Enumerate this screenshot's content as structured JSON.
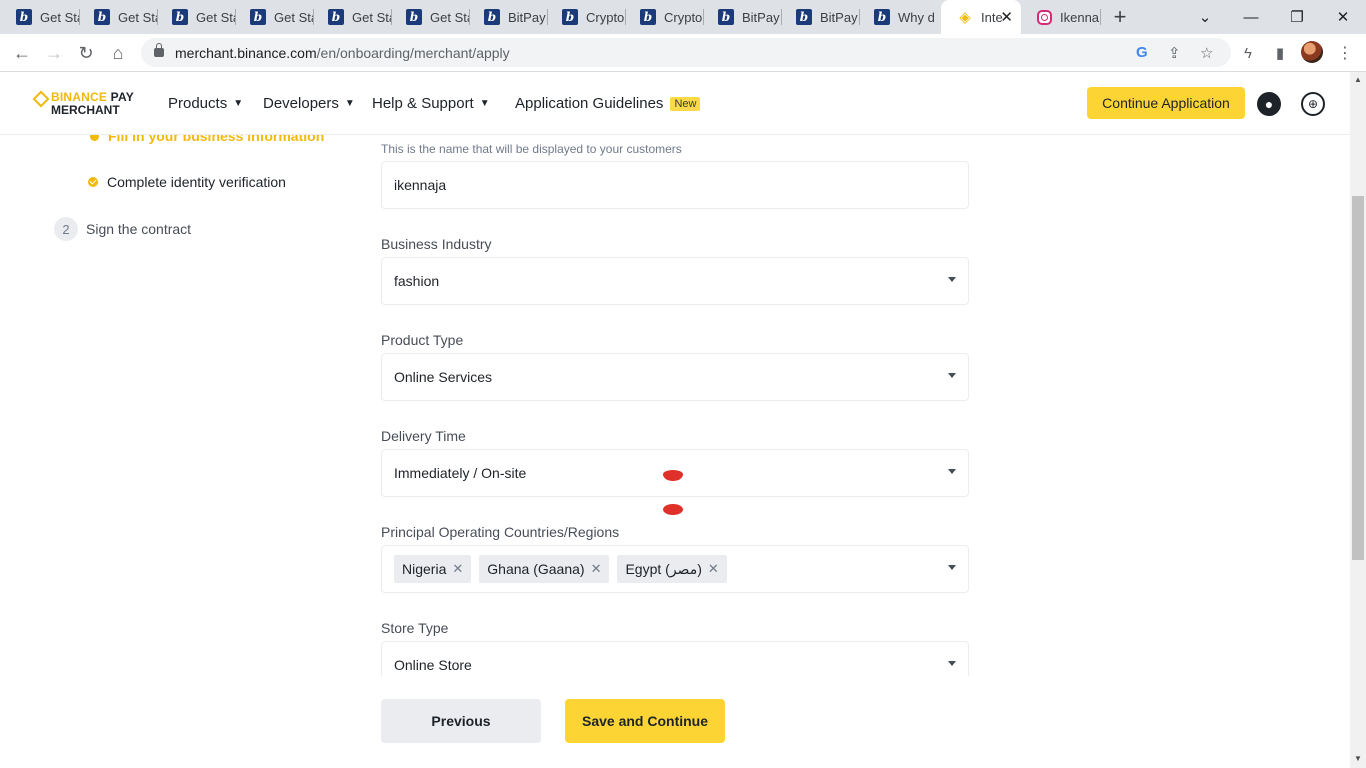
{
  "browser": {
    "tabs": [
      {
        "title": "Get Sta",
        "icon": "bitpay-icon"
      },
      {
        "title": "Get Sta",
        "icon": "bitpay-icon"
      },
      {
        "title": "Get Sta",
        "icon": "bitpay-icon"
      },
      {
        "title": "Get Sta",
        "icon": "bitpay-icon"
      },
      {
        "title": "Get Sta",
        "icon": "bitpay-icon"
      },
      {
        "title": "Get Sta",
        "icon": "bitpay-icon"
      },
      {
        "title": "BitPay",
        "icon": "bitpay-icon"
      },
      {
        "title": "Crypto",
        "icon": "bitpay-icon"
      },
      {
        "title": "Crypto",
        "icon": "bitpay-icon"
      },
      {
        "title": "BitPay",
        "icon": "bitpay-icon"
      },
      {
        "title": "BitPay",
        "icon": "bitpay-icon"
      },
      {
        "title": "Why d",
        "icon": "bitpay-icon"
      },
      {
        "title": "Inte",
        "icon": "binance-icon",
        "active": true
      },
      {
        "title": "Ikenna",
        "icon": "instagram-icon"
      }
    ],
    "url_host": "merchant.binance.com",
    "url_path": "/en/onboarding/merchant/apply"
  },
  "header": {
    "logo_brand": "BINANCE",
    "logo_pay": "PAY",
    "logo_sub": "MERCHANT",
    "nav": {
      "products": "Products",
      "developers": "Developers",
      "help": "Help & Support",
      "guidelines": "Application Guidelines",
      "new_badge": "New"
    },
    "cta": "Continue Application"
  },
  "stepper": {
    "sub_current": "Fill in your business information",
    "sub_identity": "Complete identity verification",
    "step2_number": "2",
    "step2_label": "Sign the contract"
  },
  "form": {
    "name_hint": "This is the name that will be displayed to your customers",
    "name_value": "ikennaja",
    "industry_label": "Business Industry",
    "industry_value": "fashion",
    "product_label": "Product Type",
    "product_value": "Online Services",
    "delivery_label": "Delivery Time",
    "delivery_value": "Immediately / On-site",
    "countries_label": "Principal Operating Countries/Regions",
    "countries": [
      "Nigeria",
      "Ghana (Gaana)",
      "Egypt (مصر)"
    ],
    "store_label": "Store Type",
    "store_value": "Online Store"
  },
  "buttons": {
    "previous": "Previous",
    "save": "Save and Continue"
  },
  "colors": {
    "brand_yellow": "#fcd535",
    "brand_gold": "#f0b90b",
    "text_primary": "#1e2329",
    "field_border": "#eaecef"
  }
}
